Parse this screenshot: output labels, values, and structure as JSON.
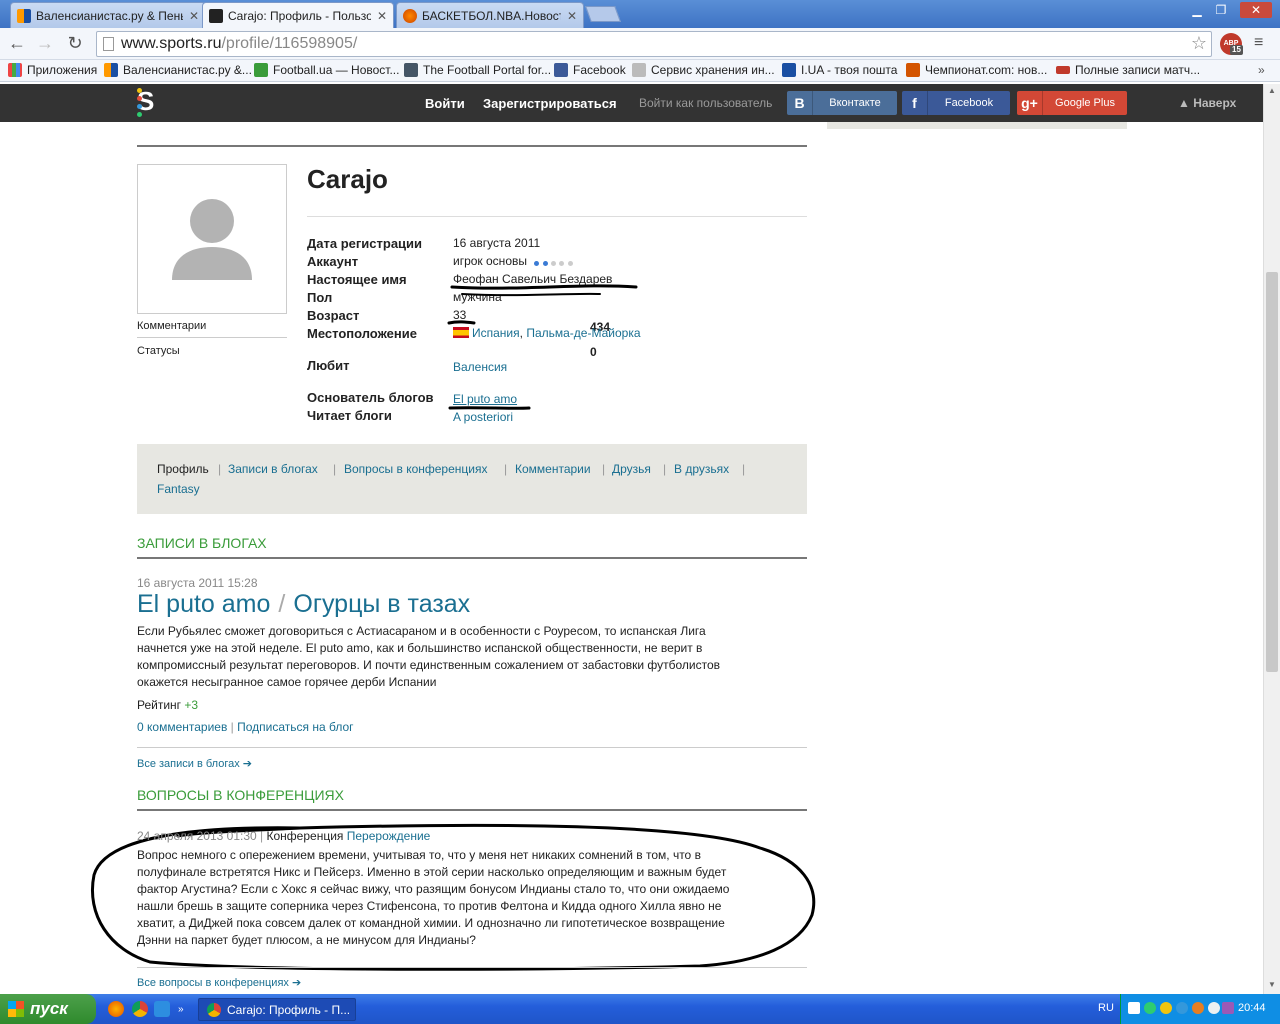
{
  "browser": {
    "tabs": [
      {
        "title": "Валенсианистас.ру & Пены"
      },
      {
        "title": "Carajo: Профиль - Пользов"
      },
      {
        "title": "БАСКЕТБОЛ.NBA.Новости б"
      }
    ],
    "url_host": "www.sports.ru",
    "url_path": "/profile/116598905/",
    "abp_label": "ABP",
    "abp_count": "15",
    "bookmarks": [
      "Приложения",
      "Валенсианистас.ру &...",
      "Football.ua — Новост...",
      "The Football Portal for...",
      "Facebook",
      "Сервис хранения ин...",
      "I.UA - твоя пошта",
      "Чемпионат.com: нов...",
      "Полные записи матч..."
    ]
  },
  "site_header": {
    "logo": "S",
    "login": "Войти",
    "register": "Зарегистрироваться",
    "login_as": "Войти как пользователь",
    "social": [
      {
        "icon": "В",
        "label": "Вконтакте",
        "color": "#4b6e99"
      },
      {
        "icon": "f",
        "label": "Facebook",
        "color": "#3b5998"
      },
      {
        "icon": "g+",
        "label": "Google Plus",
        "color": "#d34836"
      }
    ],
    "up": "▲ Наверх"
  },
  "profile": {
    "username": "Carajo",
    "stats": [
      {
        "label": "Комментарии",
        "value": "434"
      },
      {
        "label": "Статусы",
        "value": "0"
      }
    ],
    "fields": {
      "reg_label": "Дата регистрации",
      "reg_value": "16 августа 2011",
      "account_label": "Аккаунт",
      "account_value": "игрок основы",
      "account_dots": 2,
      "name_label": "Настоящее имя",
      "name_value": "Феофан Савельич Бездарев",
      "sex_label": "Пол",
      "sex_value": "мужчина",
      "age_label": "Возраст",
      "age_value": "33",
      "loc_label": "Местоположение",
      "loc_country": "Испания",
      "loc_comma": ",",
      "loc_city": "Пальма-де-Майорка",
      "loves_label": "Любит",
      "loves_value": "Валенсия",
      "founder_label": "Основатель блогов",
      "founder_value": "El puto amo",
      "reads_label": "Читает блоги",
      "reads_value": "A posteriori"
    }
  },
  "profile_tabs": [
    "Профиль",
    "Записи в блогах",
    "Вопросы в конференциях",
    "Комментарии",
    "Друзья",
    "В друзьях",
    "Fantasy"
  ],
  "blogs_section": {
    "title": "Записи в блогах",
    "date": "16 августа 2011 15:28",
    "blog_name": "El puto amo",
    "slash": "/",
    "post_title": "Огурцы в тазах",
    "text_lines": [
      "Если Рубьялес сможет договориться с Астиасараном и в особенности с Роуресом, то испанская Лига",
      "начнется уже на этой неделе. El puto amo, как и большинство испанской общественности, не верит в",
      "компромиссный результат переговоров. И почти единственным сожалением от забастовки футболистов",
      "окажется несыгранное самое горячее дерби Испании"
    ],
    "rating_label": "Рейтинг",
    "rating_value": "+3",
    "comments_link": "0 комментариев",
    "sep": "|",
    "subscribe_link": "Подписаться на блог",
    "all_link": "Все записи в блогах ➔"
  },
  "conf_section": {
    "title": "Вопросы в конференциях",
    "date": "24 апреля 2013 01:30",
    "sep": "|",
    "conf_label": "Конференция",
    "conf_name": "Перерождение",
    "text_lines": [
      "Вопрос немного с опережением времени, учитывая то, что у меня нет никаких сомнений в том, что в",
      "полуфинале встретятся Никс и Пейсерз. Именно в этой серии насколько определяющим и важным будет",
      "фактор Агустина? Если с Хокс я сейчас вижу, что разящим бонусом Индианы стало то, что они ожидаемо",
      "нашли брешь в защите соперника через Стифенсона, то против Фелтона и Кидда одного Хилла явно не",
      "хватит, а ДиДжей пока совсем далек от командной химии. И однозначно ли гипотетическое возвращение",
      "Дэнни на паркет будет плюсом, а не минусом для Индианы?"
    ],
    "all_link": "Все вопросы в конференциях ➔"
  },
  "taskbar": {
    "start": "пуск",
    "task": "Carajo: Профиль - П...",
    "lang": "RU",
    "clock": "20:44"
  }
}
